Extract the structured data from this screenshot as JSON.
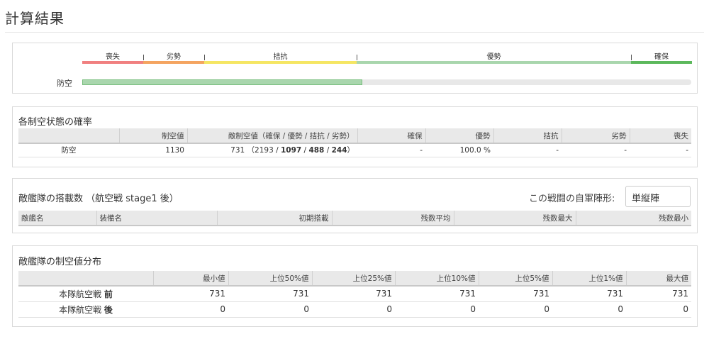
{
  "page_title": "計算結果",
  "air_state_bar": {
    "segments": [
      {
        "label": "喪失",
        "color": "#f08080"
      },
      {
        "label": "劣勢",
        "color": "#f4a460"
      },
      {
        "label": "拮抗",
        "color": "#f5e663"
      },
      {
        "label": "優勢",
        "color": "#a9d6ad"
      },
      {
        "label": "確保",
        "color": "#5cb85c"
      }
    ],
    "row_label": "防空",
    "fill_fraction": 0.46
  },
  "probability": {
    "title": "各制空状態の確率",
    "headers": [
      "",
      "制空値",
      "敵制空値（確保 / 優勢 / 拮抗 / 劣勢）",
      "確保",
      "優勢",
      "拮抗",
      "劣勢",
      "喪失"
    ],
    "row": {
      "name": "防空",
      "air_value": "1130",
      "enemy_value": "731",
      "enemy_break": {
        "open": "（",
        "v1": "2193",
        "sep1": " / ",
        "v2": "1097",
        "sep2": " / ",
        "v3": "488",
        "sep3": " / ",
        "v4": "244",
        "close": "）"
      },
      "kakuho": "-",
      "yusei": "100.0 %",
      "kikkou": "-",
      "ressei": "-",
      "soshitsu": "-"
    }
  },
  "enemy_slots": {
    "title": "敵艦隊の搭載数 （航空戦 stage1 後）",
    "formation_label": "この戦闘の自軍陣形:",
    "formation_value": "単縦陣",
    "headers": [
      "敵艦名",
      "装備名",
      "初期搭載",
      "残数平均",
      "残数最大",
      "残数最小"
    ]
  },
  "distribution": {
    "title": "敵艦隊の制空値分布",
    "headers": [
      "",
      "最小値",
      "上位50%値",
      "上位25%値",
      "上位10%値",
      "上位5%値",
      "上位1%値",
      "最大値"
    ],
    "rows": [
      {
        "name": "本隊航空戦",
        "suffix": "前",
        "values": [
          "731",
          "731",
          "731",
          "731",
          "731",
          "731",
          "731"
        ]
      },
      {
        "name": "本隊航空戦",
        "suffix": "後",
        "values": [
          "0",
          "0",
          "0",
          "0",
          "0",
          "0",
          "0"
        ]
      }
    ]
  }
}
